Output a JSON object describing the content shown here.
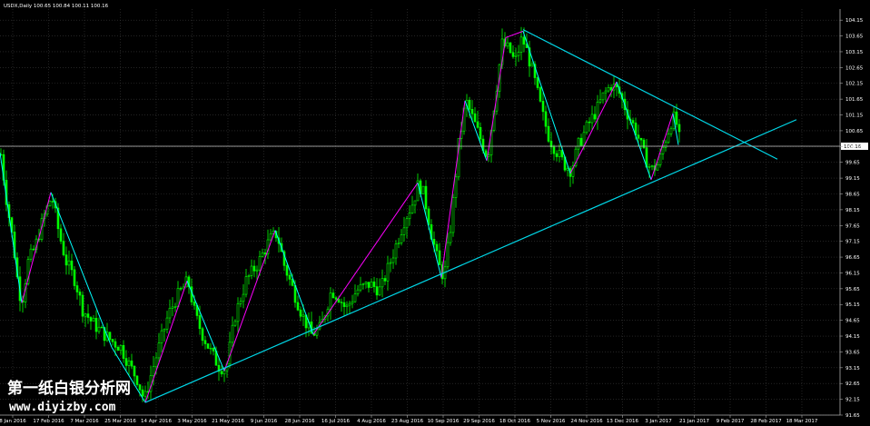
{
  "chart_data": {
    "type": "candlestick",
    "symbol_header": "USDX,Daily  100.65 100.84 100.11 100.16",
    "current_price": "100.16",
    "colors": {
      "background": "#000000",
      "grid": "#3a3a3a",
      "candle": "#00ff00",
      "zigzag_up": "#ff00ff",
      "zigzag_down": "#00ffff",
      "trendline": "#00d8e8",
      "price_line": "#c8c8c8",
      "axis_text": "#ffffff"
    },
    "ylim": [
      91.65,
      104.5
    ],
    "y_ticks": [
      "104.15",
      "103.65",
      "103.15",
      "102.65",
      "102.15",
      "101.65",
      "101.15",
      "100.65",
      "100.15",
      "99.65",
      "99.15",
      "98.65",
      "98.15",
      "97.65",
      "97.15",
      "96.65",
      "96.15",
      "95.65",
      "95.15",
      "94.65",
      "94.15",
      "93.65",
      "93.15",
      "92.65",
      "92.15",
      "91.65"
    ],
    "x_ticks": [
      "8 Jan 2016",
      "17 Feb 2016",
      "7 Mar 2016",
      "25 Mar 2016",
      "14 Apr 2016",
      "3 May 2016",
      "21 May 2016",
      "9 Jun 2016",
      "28 Jun 2016",
      "16 Jul 2016",
      "4 Aug 2016",
      "23 Aug 2016",
      "10 Sep 2016",
      "29 Sep 2016",
      "18 Oct 2016",
      "5 Nov 2016",
      "24 Nov 2016",
      "13 Dec 2016",
      "3 Jan 2017",
      "21 Jan 2017",
      "9 Feb 2017",
      "28 Feb 2017",
      "18 Mar 2017",
      "6 Apr 2017"
    ],
    "price_path": [
      [
        0,
        99.9
      ],
      [
        6,
        98.5
      ],
      [
        14,
        97.0
      ],
      [
        20,
        95.5
      ],
      [
        24,
        95.4
      ],
      [
        30,
        96.5
      ],
      [
        38,
        97.0
      ],
      [
        46,
        97.8
      ],
      [
        56,
        98.6
      ],
      [
        64,
        97.4
      ],
      [
        72,
        96.5
      ],
      [
        82,
        95.9
      ],
      [
        90,
        95.0
      ],
      [
        100,
        94.6
      ],
      [
        110,
        94.3
      ],
      [
        122,
        94.0
      ],
      [
        132,
        93.8
      ],
      [
        142,
        93.2
      ],
      [
        150,
        92.8
      ],
      [
        158,
        92.1
      ],
      [
        164,
        92.8
      ],
      [
        174,
        93.8
      ],
      [
        184,
        94.8
      ],
      [
        194,
        95.4
      ],
      [
        206,
        95.9
      ],
      [
        214,
        94.8
      ],
      [
        222,
        94.2
      ],
      [
        232,
        93.6
      ],
      [
        240,
        93.2
      ],
      [
        248,
        93.1
      ],
      [
        258,
        94.8
      ],
      [
        270,
        95.9
      ],
      [
        284,
        96.5
      ],
      [
        296,
        97.2
      ],
      [
        304,
        97.4
      ],
      [
        312,
        96.4
      ],
      [
        322,
        95.6
      ],
      [
        332,
        94.8
      ],
      [
        342,
        94.2
      ],
      [
        352,
        94.4
      ],
      [
        364,
        95.6
      ],
      [
        372,
        95.4
      ],
      [
        380,
        95.0
      ],
      [
        392,
        95.6
      ],
      [
        406,
        95.8
      ],
      [
        418,
        95.6
      ],
      [
        430,
        96.6
      ],
      [
        444,
        97.8
      ],
      [
        454,
        98.4
      ],
      [
        460,
        99.0
      ],
      [
        466,
        98.6
      ],
      [
        474,
        97.4
      ],
      [
        482,
        96.4
      ],
      [
        488,
        96.0
      ],
      [
        496,
        97.8
      ],
      [
        504,
        100.2
      ],
      [
        512,
        101.6
      ],
      [
        520,
        101.0
      ],
      [
        528,
        100.4
      ],
      [
        536,
        99.8
      ],
      [
        542,
        101.2
      ],
      [
        552,
        103.4
      ],
      [
        560,
        103.2
      ],
      [
        566,
        102.8
      ],
      [
        574,
        103.6
      ],
      [
        580,
        103.1
      ],
      [
        588,
        102.2
      ],
      [
        596,
        101.2
      ],
      [
        604,
        100.4
      ],
      [
        612,
        100.0
      ],
      [
        620,
        99.6
      ],
      [
        628,
        99.4
      ],
      [
        636,
        100.2
      ],
      [
        646,
        100.8
      ],
      [
        656,
        101.3
      ],
      [
        664,
        101.8
      ],
      [
        672,
        102.1
      ],
      [
        680,
        101.9
      ],
      [
        690,
        101.2
      ],
      [
        700,
        100.6
      ],
      [
        708,
        99.9
      ],
      [
        716,
        99.4
      ],
      [
        724,
        99.6
      ],
      [
        732,
        100.4
      ],
      [
        740,
        101.1
      ],
      [
        745,
        100.8
      ],
      [
        748,
        100.2
      ]
    ],
    "zigzag": [
      [
        0,
        99.95
      ],
      [
        24,
        95.2
      ],
      [
        56,
        98.7
      ],
      [
        123,
        93.8
      ],
      [
        160,
        92.05
      ],
      [
        206,
        95.9
      ],
      [
        247,
        93.05
      ],
      [
        303,
        97.5
      ],
      [
        345,
        94.2
      ],
      [
        460,
        99.0
      ],
      [
        486,
        96.0
      ],
      [
        512,
        101.6
      ],
      [
        536,
        99.7
      ],
      [
        557,
        103.6
      ],
      [
        576,
        103.8
      ],
      [
        628,
        99.3
      ],
      [
        679,
        102.2
      ],
      [
        717,
        99.1
      ],
      [
        741,
        101.2
      ],
      [
        747,
        100.2
      ]
    ],
    "trendlines": [
      {
        "from": [
          160,
          92.05
        ],
        "to": [
          877,
          101.0
        ]
      },
      {
        "from": [
          576,
          103.85
        ],
        "to": [
          856,
          99.75
        ]
      }
    ],
    "watermark": [
      "第一纸白银分析网",
      "www.diyizby.com"
    ]
  }
}
